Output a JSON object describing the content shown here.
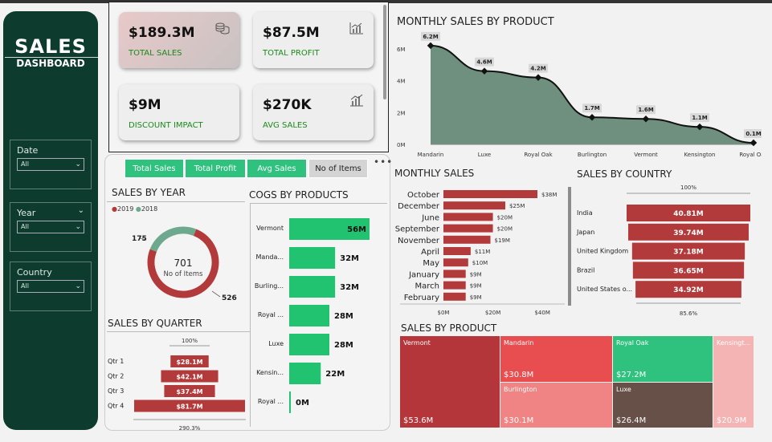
{
  "sidebar": {
    "title": "SALES",
    "subtitle": "DASHBOARD",
    "filters": [
      {
        "label": "Date",
        "value": "All"
      },
      {
        "label": "Year",
        "value": "All"
      },
      {
        "label": "Country",
        "value": "All"
      }
    ]
  },
  "kpis": [
    {
      "value": "$189.3M",
      "label": "TOTAL SALES",
      "icon": "coins-icon"
    },
    {
      "value": "$87.5M",
      "label": "TOTAL PROFIT",
      "icon": "chart-up-icon"
    },
    {
      "value": "$9M",
      "label": "DISCOUNT IMPACT",
      "icon": ""
    },
    {
      "value": "$270K",
      "label": "AVG SALES",
      "icon": "bar-chart-icon"
    }
  ],
  "toggle_buttons": [
    "Total Sales",
    "Total Profit",
    "Avg Sales",
    "No of Items"
  ],
  "more_menu": "•••",
  "sales_by_year": {
    "title": "SALES BY YEAR",
    "legend": [
      "2019",
      "2018"
    ],
    "colors": [
      "#b23a3a",
      "#6ea88f"
    ],
    "center_value": "701",
    "center_label": "No of Items",
    "label_2018": "175",
    "label_2019": "526"
  },
  "cogs_by_products": {
    "title": "COGS BY PRODUCTS",
    "categories": [
      "Vermont",
      "Manda...",
      "Burling...",
      "Royal ...",
      "Luxe",
      "Kensin...",
      "Royal ..."
    ],
    "labels": [
      "56M",
      "32M",
      "32M",
      "28M",
      "28M",
      "22M",
      "0M"
    ]
  },
  "sales_by_quarter": {
    "title": "SALES BY QUARTER",
    "top_label": "100%",
    "bottom_label": "290.3%",
    "categories": [
      "Qtr 1",
      "Qtr 2",
      "Qtr 3",
      "Qtr 4"
    ],
    "labels": [
      "$28.1M",
      "$42.1M",
      "$37.4M",
      "$81.7M"
    ]
  },
  "monthly_sales_by_product": {
    "title": "MONTHLY SALES BY PRODUCT",
    "y_ticks": [
      "6M",
      "4M",
      "2M",
      "0M"
    ],
    "data_labels": [
      "6.2M",
      "4.6M",
      "4.2M",
      "1.7M",
      "1.6M",
      "1.1M",
      "0.1M"
    ]
  },
  "monthly_sales": {
    "title": "MONTHLY SALES",
    "x_ticks": [
      "$0M",
      "$20M",
      "$40M"
    ],
    "labels": [
      "$38M",
      "$25M",
      "$20M",
      "$20M",
      "$19M",
      "$11M",
      "$10M",
      "$9M",
      "$9M",
      "$9M"
    ]
  },
  "sales_by_country": {
    "title": "SALES BY COUNTRY",
    "top_label": "100%",
    "bottom_label": "85.6%",
    "labels": [
      "40.81M",
      "39.74M",
      "37.18M",
      "36.65M",
      "34.92M"
    ]
  },
  "sales_by_product": {
    "title": "SALES BY PRODUCT",
    "tiles": [
      {
        "name": "Vermont",
        "value": "$53.6M",
        "color": "#b5363a"
      },
      {
        "name": "Mandarin",
        "value": "$30.8M",
        "color": "#e84e50"
      },
      {
        "name": "Royal Oak",
        "value": "$27.2M",
        "color": "#2ec27e"
      },
      {
        "name": "Kensingt...",
        "value": "$20.9M",
        "color": "#f4b4b4"
      },
      {
        "name": "Burlington",
        "value": "$30.1M",
        "color": "#f08383"
      },
      {
        "name": "Luxe",
        "value": "$26.4M",
        "color": "#665048"
      }
    ]
  },
  "chart_data": [
    {
      "type": "area",
      "title": "MONTHLY SALES BY PRODUCT",
      "categories": [
        "Mandarin",
        "Luxe",
        "Royal Oak",
        "Burlington",
        "Vermont",
        "Kensington",
        "Royal Oak"
      ],
      "values": [
        6.2,
        4.6,
        4.2,
        1.7,
        1.6,
        1.1,
        0.1
      ],
      "ylim": [
        0,
        7
      ],
      "color": "#6f8f7f"
    },
    {
      "type": "bar",
      "orientation": "horizontal",
      "title": "MONTHLY SALES",
      "categories": [
        "October",
        "December",
        "June",
        "September",
        "November",
        "April",
        "May",
        "January",
        "March",
        "February"
      ],
      "values": [
        38,
        25,
        20,
        20,
        19,
        11,
        10,
        9,
        9,
        9
      ],
      "xlim": [
        0,
        45
      ],
      "color": "#b23a3a"
    },
    {
      "type": "bar",
      "orientation": "horizontal",
      "title": "SALES BY COUNTRY",
      "categories": [
        "India",
        "Japan",
        "United Kingdom",
        "Brazil",
        "United States o..."
      ],
      "values": [
        40.81,
        39.74,
        37.18,
        36.65,
        34.92
      ],
      "color": "#b23a3a"
    },
    {
      "type": "bar",
      "orientation": "horizontal",
      "title": "COGS BY PRODUCTS",
      "categories": [
        "Vermont",
        "Manda...",
        "Burling...",
        "Royal ...",
        "Luxe",
        "Kensin...",
        "Royal ..."
      ],
      "values": [
        56,
        32,
        32,
        28,
        28,
        22,
        0
      ],
      "color": "#22c370"
    },
    {
      "type": "bar",
      "orientation": "horizontal",
      "title": "SALES BY QUARTER",
      "categories": [
        "Qtr 1",
        "Qtr 2",
        "Qtr 3",
        "Qtr 4"
      ],
      "values": [
        28.1,
        42.1,
        37.4,
        81.7
      ],
      "color": "#b23a3a"
    },
    {
      "type": "pie",
      "title": "SALES BY YEAR",
      "categories": [
        "2019",
        "2018"
      ],
      "values": [
        526,
        175
      ],
      "colors": [
        "#b23a3a",
        "#6ea88f"
      ]
    }
  ]
}
